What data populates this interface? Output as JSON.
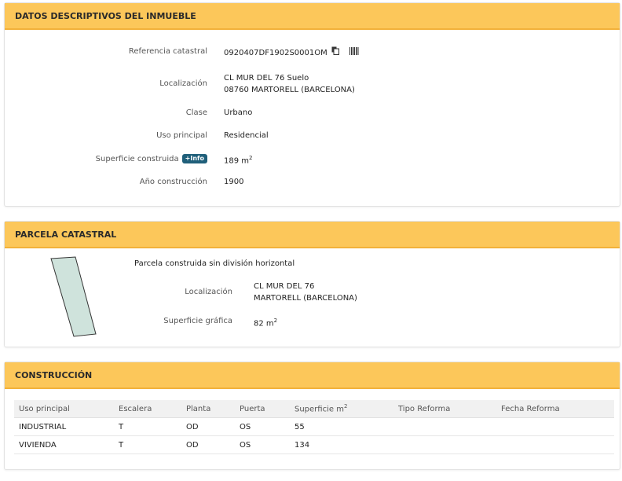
{
  "datos": {
    "title": "DATOS DESCRIPTIVOS DEL INMUEBLE",
    "ref_label": "Referencia catastral",
    "ref_value": "0920407DF1902S0001OM",
    "loc_label": "Localización",
    "loc_line1": "CL MUR DEL 76 Suelo",
    "loc_line2": "08760 MARTORELL (BARCELONA)",
    "clase_label": "Clase",
    "clase_value": "Urbano",
    "uso_label": "Uso principal",
    "uso_value": "Residencial",
    "sup_label": "Superficie construida",
    "info_badge": "+Info",
    "sup_value": "189 m",
    "sup_exp": "2",
    "anio_label": "Año construcción",
    "anio_value": "1900"
  },
  "parcela": {
    "title": "PARCELA CATASTRAL",
    "subtitle": "Parcela construida sin división horizontal",
    "loc_label": "Localización",
    "loc_line1": "CL MUR DEL 76",
    "loc_line2": "MARTORELL (BARCELONA)",
    "sup_label": "Superficie gráfica",
    "sup_value": "82 m",
    "sup_exp": "2",
    "shape_fill": "#cfe3dc"
  },
  "construccion": {
    "title": "CONSTRUCCIÓN",
    "headers": [
      "Uso principal",
      "Escalera",
      "Planta",
      "Puerta",
      "Superficie m",
      "Tipo Reforma",
      "Fecha Reforma"
    ],
    "sup_header_exp": "2",
    "rows": [
      [
        "INDUSTRIAL",
        "T",
        "OD",
        "OS",
        "55",
        "",
        ""
      ],
      [
        "VIVIENDA",
        "T",
        "OD",
        "OS",
        "134",
        "",
        ""
      ]
    ]
  },
  "colors": {
    "header_bg": "#fcc75a",
    "badge_bg": "#1f5f7a"
  }
}
